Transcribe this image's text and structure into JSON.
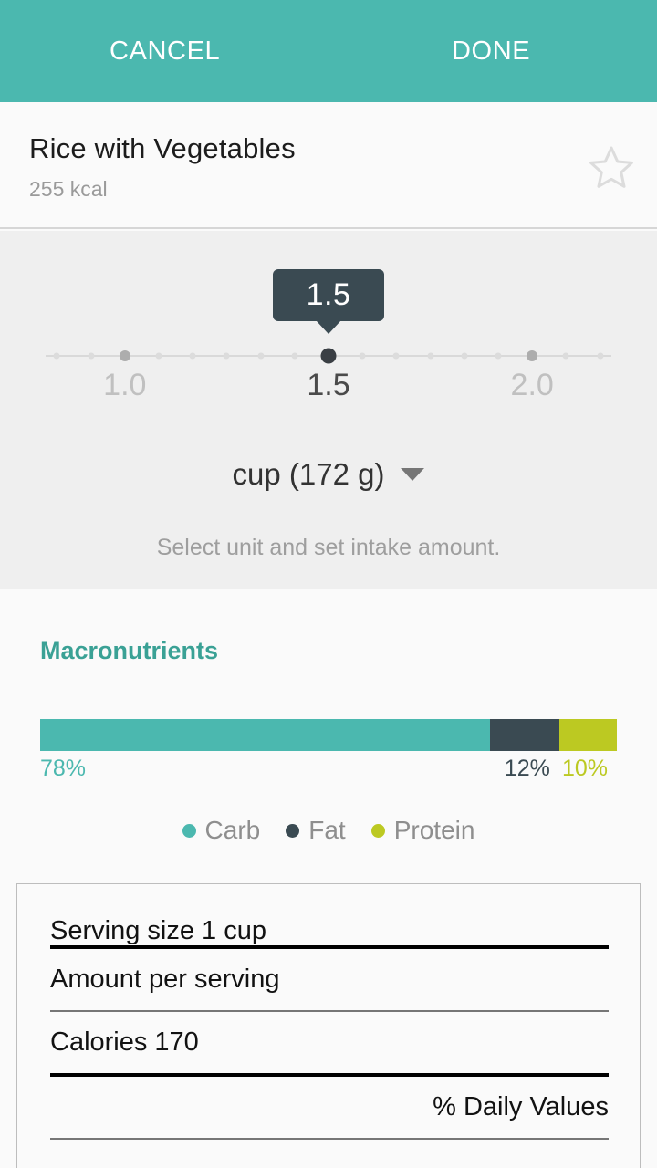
{
  "topbar": {
    "cancel_label": "CANCEL",
    "done_label": "DONE",
    "background_color": "#4bb8af"
  },
  "food": {
    "title": "Rice with Vegetables",
    "calories_text": "255 kcal",
    "favorite_icon": "star-outline-icon",
    "is_favorite": false
  },
  "serving_selector": {
    "tooltip_value": "1.5",
    "current_value": 1.5,
    "scale_labels": [
      {
        "text": "1.0",
        "value": 1.0,
        "active": false,
        "pos_pct": 14
      },
      {
        "text": "1.5",
        "value": 1.5,
        "active": true,
        "pos_pct": 50
      },
      {
        "text": "2.0",
        "value": 2.0,
        "active": false,
        "pos_pct": 86
      }
    ],
    "ticks": [
      {
        "pos_pct": 2,
        "kind": "minor"
      },
      {
        "pos_pct": 8,
        "kind": "minor"
      },
      {
        "pos_pct": 14,
        "kind": "major"
      },
      {
        "pos_pct": 20,
        "kind": "minor"
      },
      {
        "pos_pct": 26,
        "kind": "minor"
      },
      {
        "pos_pct": 32,
        "kind": "minor"
      },
      {
        "pos_pct": 38,
        "kind": "minor"
      },
      {
        "pos_pct": 44,
        "kind": "minor"
      },
      {
        "pos_pct": 50,
        "kind": "active"
      },
      {
        "pos_pct": 56,
        "kind": "minor"
      },
      {
        "pos_pct": 62,
        "kind": "minor"
      },
      {
        "pos_pct": 68,
        "kind": "minor"
      },
      {
        "pos_pct": 74,
        "kind": "minor"
      },
      {
        "pos_pct": 80,
        "kind": "minor"
      },
      {
        "pos_pct": 86,
        "kind": "major"
      },
      {
        "pos_pct": 92,
        "kind": "minor"
      },
      {
        "pos_pct": 98,
        "kind": "minor"
      }
    ],
    "unit_label": "cup (172 g)",
    "unit_caret_icon": "chevron-down-icon",
    "hint_text": "Select unit and set intake amount."
  },
  "macronutrients": {
    "title": "Macronutrients",
    "segments": [
      {
        "name": "Carb",
        "percent_text": "78%",
        "percent": 78,
        "color": "#4bb8af"
      },
      {
        "name": "Fat",
        "percent_text": "12%",
        "percent": 12,
        "color": "#3a4a52"
      },
      {
        "name": "Protein",
        "percent_text": "10%",
        "percent": 10,
        "color": "#bcc922"
      }
    ]
  },
  "nutrition_facts": {
    "serving_size": "Serving size 1 cup",
    "amount_per_serving": "Amount per serving",
    "calories": "Calories 170",
    "daily_values_header": "% Daily Values"
  },
  "chart_data": {
    "type": "bar",
    "orientation": "horizontal-stacked",
    "title": "Macronutrients",
    "categories": [
      "Carb",
      "Fat",
      "Protein"
    ],
    "values": [
      78,
      12,
      10
    ],
    "value_labels": [
      "78%",
      "12%",
      "10%"
    ],
    "colors": [
      "#4bb8af",
      "#3a4a52",
      "#bcc922"
    ],
    "unit": "percent",
    "total": 100,
    "legend": [
      "Carb",
      "Fat",
      "Protein"
    ],
    "legend_position": "bottom-center",
    "grid": false,
    "xlabel": "",
    "ylabel": ""
  }
}
